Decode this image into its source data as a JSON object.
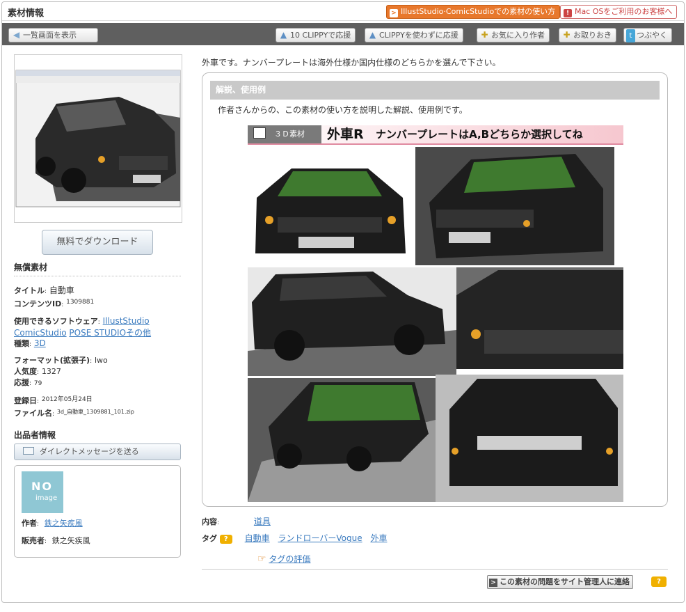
{
  "header": {
    "title": "素材情報",
    "btn_guide": "IllustStudio·ComicStudioでの素材の使い方",
    "btn_mac": "Mac OSをご利用のお客様へ"
  },
  "toolbar": {
    "back": "一覧画面を表示",
    "clippy10": "10 CLIPPYで応援",
    "clippy_free": "CLIPPYを使わずに応援",
    "fav_author": "お気に入り作者",
    "bookmark": "お取りおき",
    "tweet": "つぶやく"
  },
  "left": {
    "download": "無料でダウンロード",
    "material_type": "無償素材",
    "title_label": "タイトル",
    "title_value": "自動車",
    "content_id_label": "コンテンツID",
    "content_id": "1309881",
    "software_label": "使用できるソフトウェア",
    "software_links": [
      "IllustStudio",
      "ComicStudio",
      "POSE STUDIO",
      "その他"
    ],
    "kind_label": "種類",
    "kind_value": "3D",
    "format_label": "フォーマット(拡張子)",
    "format_value": "lwo",
    "popularity_label": "人気度",
    "popularity_value": "1327",
    "support_label": "応援",
    "support_value": "79",
    "date_label": "登録日",
    "date_value": "2012年05月24日",
    "filename_label": "ファイル名",
    "filename_value": "3d_自動車_1309881_101.zip",
    "seller_section": "出品者情報",
    "message_btn": "ダイレクトメッセージを送る",
    "noimage_top": "NO",
    "noimage_bottom": "image",
    "author_label": "作者",
    "author_value": "鉄之矢疾風",
    "vendor_label": "販売者",
    "vendor_value": "鉄之矢疾風"
  },
  "main": {
    "description": "外車です。ナンバープレートは海外仕様か国内仕様のどちらかを選んで下さい。",
    "box_title": "解説、使用例",
    "box_text": "作者さんからの、この素材の使い方を説明した解説、使用例です。",
    "banner_tag": "３Ｄ素材",
    "banner_title": "外車R",
    "banner_text": "ナンバープレートはA,Bどちらか選択してね",
    "content_label": "内容",
    "content_value": "道具",
    "tags_label": "タグ",
    "tags": [
      "自動車",
      "ランドローバーVogue",
      "外車"
    ],
    "tag_eval": "タグの評価",
    "report": "この素材の問題をサイト管理人に連絡"
  },
  "colors": {
    "accent_orange": "#e8782c",
    "link_blue": "#3b7bbf",
    "toolbar_gray": "#5f5f5f",
    "banner_pink": "#f6c7cf"
  }
}
